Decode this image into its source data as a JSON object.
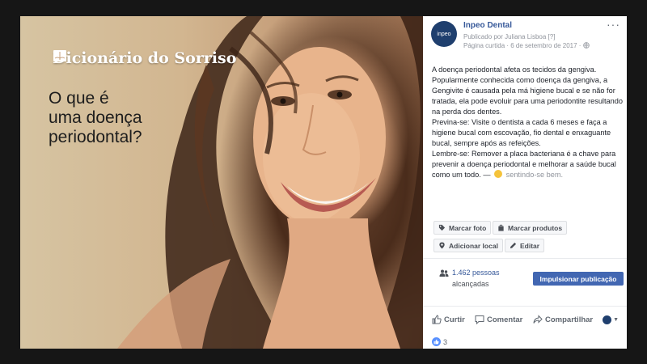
{
  "image": {
    "brand_title": "Dicionário do Sorriso",
    "headline": [
      "O que é",
      "uma doença",
      "periodontal?"
    ]
  },
  "post": {
    "page_name": "Inpeo Dental",
    "published_by": "Publicado por Juliana Lisboa [?]",
    "liked_page_date": "Página curtida · 6 de setembro de 2017 · ",
    "more": "···",
    "avatar_text": "inpeo",
    "text": {
      "p1": "A doença periodontal afeta os tecidos da gengiva. Popularmente conhecida como doença da gengiva, a Gengivite é causada pela má higiene bucal e se não for tratada, ela pode evoluir para uma periodontite resultando na perda dos dentes.",
      "p2": "Previna-se: Visite o dentista a cada 6 meses e faça a higiene bucal com escovação, fio dental e enxaguante bucal, sempre após as refeições.",
      "p3": "Lembre-se: Remover a placa bacteriana é a chave para prevenir a doença periodontal e melhorar a saúde bucal como um todo. — ",
      "feeling": " sentindo-se bem."
    },
    "buttons": {
      "tag_photo": "Marcar foto",
      "tag_products": "Marcar produtos",
      "add_location": "Adicionar local",
      "edit": "Editar"
    },
    "reach": {
      "count": "1.462 pessoas",
      "label": "alcançadas"
    },
    "boost_label": "Impulsionar publicação",
    "actions": {
      "like": "Curtir",
      "comment": "Comentar",
      "share": "Compartilhar"
    },
    "likes_count": "3"
  },
  "colors": {
    "link": "#365899",
    "boost": "#4267b2",
    "background": "#161616"
  }
}
